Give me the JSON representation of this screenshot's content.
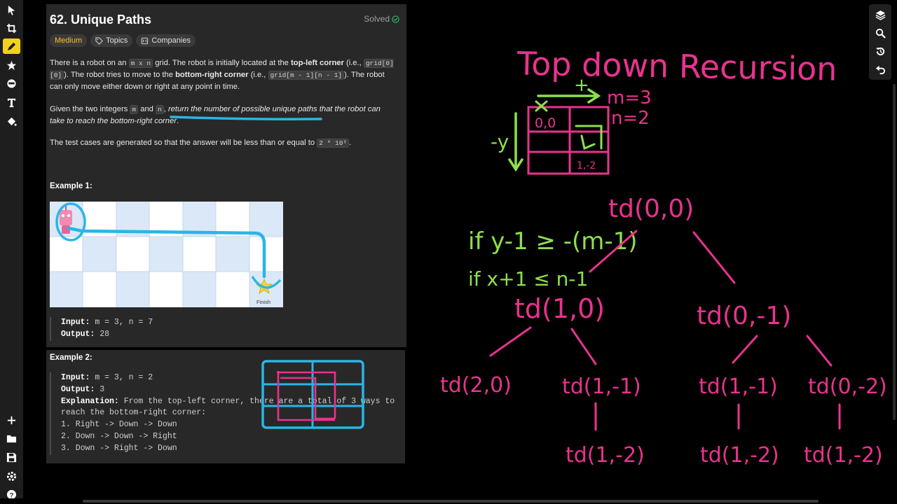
{
  "problem": {
    "title": "62. Unique Paths",
    "status": "Solved",
    "difficulty": "Medium",
    "chips": [
      "Topics",
      "Companies"
    ],
    "desc1": {
      "t1": "There is a robot on an ",
      "c1": "m x n",
      "t2": " grid. The robot is initially located at the ",
      "b1": "top-left corner",
      "t3": " (i.e., ",
      "c2": "grid[0][0]",
      "t4": "). The robot tries to move to the ",
      "b2": "bottom-right corner",
      "t5": " (i.e., ",
      "c3": "grid[m - 1][n - 1]",
      "t6": "). The robot can only move either down or right at any point in time."
    },
    "desc2": {
      "t1": "Given the two integers ",
      "c1": "m",
      "t2": " and ",
      "c2": "n",
      "t3": ", ",
      "i1": "return the number of possible unique paths that the robot can take to reach the bottom-right corner",
      "t4": "."
    },
    "desc3": {
      "t1": "The test cases are generated so that the answer will be less than or equal to ",
      "c1": "2 * 10⁹",
      "t2": "."
    },
    "example1": {
      "title": "Example 1:",
      "input_label": "Input:",
      "input": " m = 3, n = 7",
      "output_label": "Output:",
      "output": " 28",
      "finish_label": "Finish"
    },
    "example2": {
      "title": "Example 2:",
      "input_label": "Input:",
      "input": " m = 3, n = 2",
      "output_label": "Output:",
      "output": " 3",
      "explanation_label": "Explanation:",
      "explanation": " From the top-left corner, there are a total of 3 ways to\nreach the bottom-right corner:\n1. Right -> Down -> Down\n2. Down -> Down -> Right\n3. Down -> Right -> Down"
    }
  },
  "notes": {
    "heading": "Top down Recursion",
    "m_label": "m=3",
    "n_label": "n=2",
    "plus": "+",
    "minus_y": "-y",
    "cell_start": "0,0",
    "cell_end": "1,-2",
    "cond1": "if y-1 ≥ -(m-1)",
    "cond2": "if x+1 ≤ n-1",
    "nodes": [
      "td(0,0)",
      "td(1,0)",
      "td(0,-1)",
      "td(2,0)",
      "td(1,-1)",
      "td(1,-1)",
      "td(0,-2)",
      "td(1,-2)",
      "td(1,-2)",
      "td(1,-2)"
    ]
  },
  "colors": {
    "pink": "#e8338e",
    "green": "#8ee04a",
    "cyan": "#29b6e6",
    "accent": "#f2d21b",
    "medium": "#ffc01e"
  }
}
